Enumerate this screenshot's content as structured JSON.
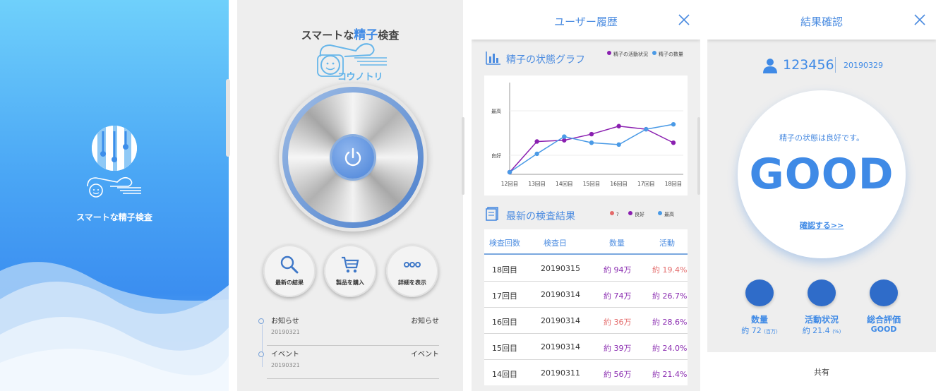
{
  "splash": {
    "tagline": "スマートな精子検査",
    "logo_text": "コウノトリ",
    "colors": {
      "gradient_top": "#6fd0fb",
      "gradient_bottom": "#3b8ef0"
    }
  },
  "home": {
    "title_pre": "スマートな",
    "title_hl": "精子",
    "title_post": "検査",
    "logo_text": "コウノトリ",
    "power_icon": "power-icon",
    "buttons": [
      {
        "label": "最新の結果",
        "icon": "search-icon"
      },
      {
        "label": "製品を購入",
        "icon": "cart-icon"
      },
      {
        "label": "詳細を表示",
        "icon": "more-icon"
      }
    ],
    "notices": [
      {
        "title": "お知らせ",
        "tag": "お知らせ",
        "date": "20190321"
      },
      {
        "title": "イベント",
        "tag": "イベント",
        "date": "20190321"
      }
    ]
  },
  "history": {
    "header": "ユーザー履歴",
    "graph_title": "精子の状態グラフ",
    "graph_legend": [
      {
        "label": "精子の活動状況",
        "color": "#8a1fb0"
      },
      {
        "label": "精子の数量",
        "color": "#4a9ae6"
      }
    ],
    "results_title": "最新の検査結果",
    "results_legend": [
      {
        "label": "?",
        "color": "#e36a6a"
      },
      {
        "label": "良好",
        "color": "#8a1fb0"
      },
      {
        "label": "最高",
        "color": "#4a9ae6"
      }
    ],
    "table": {
      "headers": [
        "検査回数",
        "検査日",
        "数量",
        "活動"
      ],
      "rows": [
        {
          "n": "18回目",
          "date": "20190315",
          "count": "約 94万",
          "activity": "約 19.4%",
          "count_status": "good",
          "activity_status": "bad"
        },
        {
          "n": "17回目",
          "date": "20190314",
          "count": "約 74万",
          "activity": "約 26.7%",
          "count_status": "good",
          "activity_status": "good"
        },
        {
          "n": "16回目",
          "date": "20190314",
          "count": "約 36万",
          "activity": "約 28.6%",
          "count_status": "bad",
          "activity_status": "good"
        },
        {
          "n": "15回目",
          "date": "20190314",
          "count": "約 39万",
          "activity": "約 24.0%",
          "count_status": "good",
          "activity_status": "good"
        },
        {
          "n": "14回目",
          "date": "20190311",
          "count": "約 56万",
          "activity": "約 21.4%",
          "count_status": "good",
          "activity_status": "good"
        }
      ]
    }
  },
  "chart_data": {
    "type": "line",
    "categories": [
      "12回目",
      "13回目",
      "14回目",
      "15回目",
      "16回目",
      "17回目",
      "18回目"
    ],
    "y_tick_labels": [
      "最高",
      "良好"
    ],
    "series": [
      {
        "name": "精子の活動状況",
        "color": "#8a1fb0",
        "values": [
          0.0,
          0.5,
          0.52,
          0.62,
          0.75,
          0.7,
          0.48
        ]
      },
      {
        "name": "精子の数量",
        "color": "#4a9ae6",
        "values": [
          0.0,
          0.3,
          0.58,
          0.48,
          0.45,
          0.7,
          0.78
        ]
      }
    ],
    "grid": "horizontal",
    "legend": "top-right"
  },
  "result": {
    "header": "結果確認",
    "user_id": "123456",
    "date": "20190329",
    "message": "精子の状態は良好です。",
    "grade": "GOOD",
    "link": "確認する>>",
    "stats": [
      {
        "label": "数量",
        "value": "約 72",
        "unit": "(百万)"
      },
      {
        "label": "活動状況",
        "value": "約 21.4",
        "unit": "(%)"
      },
      {
        "label": "総合評価",
        "value": "GOOD",
        "unit": ""
      }
    ],
    "share": "共有"
  }
}
